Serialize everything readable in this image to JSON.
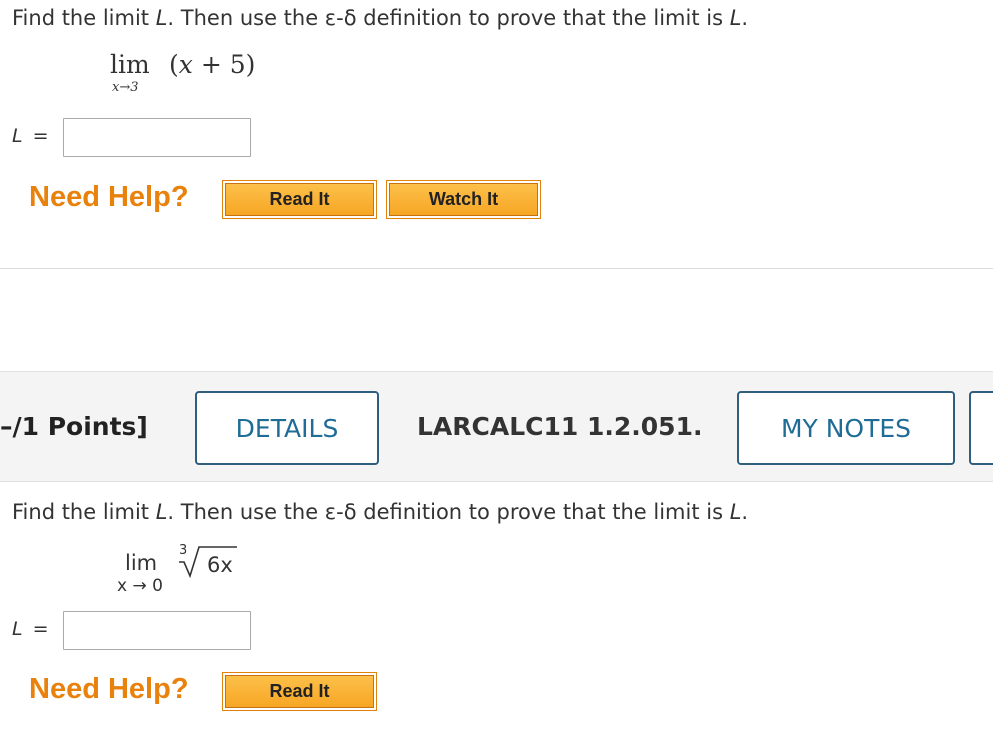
{
  "problem1": {
    "prompt_start": "Find the limit ",
    "prompt_var": "L",
    "prompt_mid": ". Then use the ε-δ definition to prove that the limit is ",
    "prompt_end_var": "L",
    "prompt_end": ".",
    "limit_word": "lim",
    "limit_sub": "x→3",
    "expr_open": "(",
    "expr_var": "x",
    "expr_rest": " + 5)",
    "answer_label": "L",
    "answer_eq": "=",
    "answer_value": "",
    "need_help": "Need Help?",
    "read_it": "Read It",
    "watch_it": "Watch It"
  },
  "question_header": {
    "points": "–/1 Points]",
    "details": "DETAILS",
    "code": "LARCALC11 1.2.051.",
    "my_notes": "MY NOTES"
  },
  "problem2": {
    "prompt_start": "Find the limit ",
    "prompt_var": "L",
    "prompt_mid": ". Then use the ε-δ definition to prove that the limit is ",
    "prompt_end_var": "L",
    "prompt_end": ".",
    "limit_word": "lim",
    "limit_sub": "x → 0",
    "root_index": "3",
    "radicand": "6x",
    "answer_label": "L",
    "answer_eq": "=",
    "answer_value": "",
    "need_help": "Need Help?",
    "read_it": "Read It"
  },
  "colors": {
    "help_orange": "#e8820d",
    "button_gold": "#f7a624",
    "outline_blue": "#1f6c97",
    "header_gray": "#f4f4f4"
  }
}
